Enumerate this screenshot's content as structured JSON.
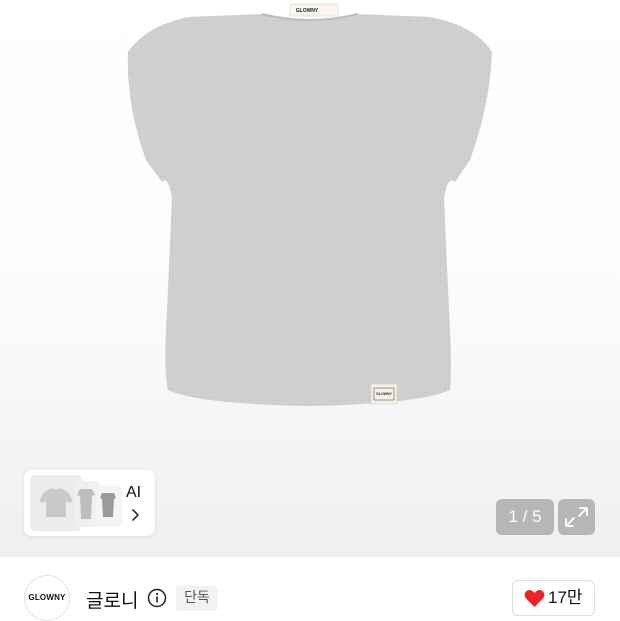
{
  "product": {
    "image_icon": "tshirt-image",
    "shirt_color": "#cfcfcf",
    "label_text": "GLOWNY"
  },
  "ai_recommend": {
    "label": "AI",
    "chevron_icon": "chevron-right-icon"
  },
  "gallery": {
    "counter": "1 / 5",
    "expand_icon": "expand-icon"
  },
  "brand": {
    "logo_text": "GLOWNY",
    "name": "글로니",
    "info_icon": "info-icon",
    "badge": "단독"
  },
  "like": {
    "icon": "heart-icon",
    "heart_color": "#e8232c",
    "count": "17만"
  }
}
